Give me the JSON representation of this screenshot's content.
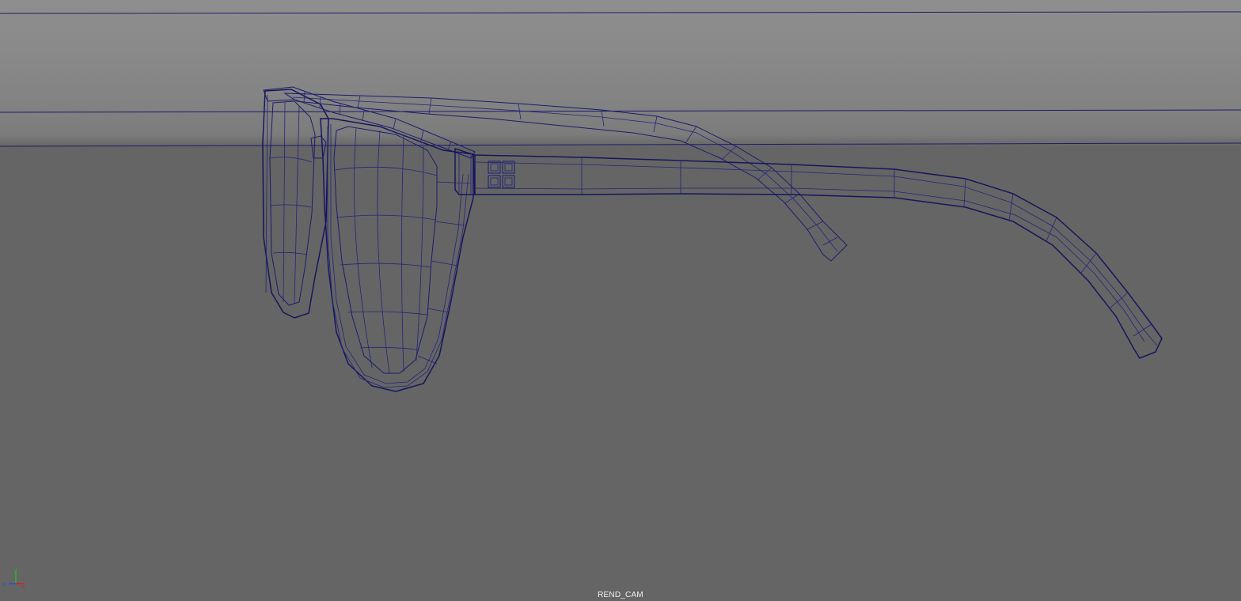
{
  "viewport": {
    "camera_label": "REND_CAM",
    "background_top_color": "#8e8e8e",
    "background_bottom_color": "#656565",
    "wireframe_color": "#1c1c6e",
    "model_fill_color": "#9c9c9c",
    "lens_fill_color": "#808080"
  },
  "axis_gizmo": {
    "icon": "xyz-axis-gizmo-icon",
    "x_label": "x",
    "y_label": "y",
    "z_label": "z",
    "x_color": "#d22020",
    "y_color": "#2ab82a",
    "z_color": "#2a4ad8"
  }
}
